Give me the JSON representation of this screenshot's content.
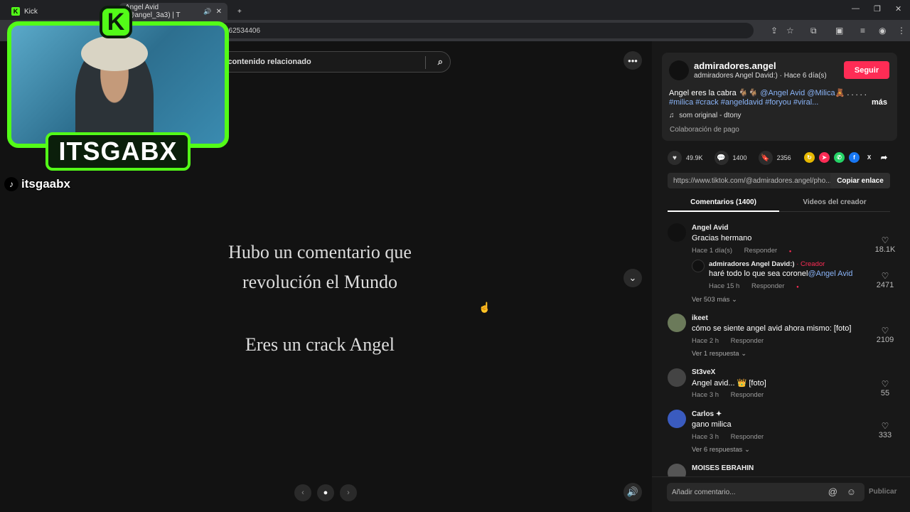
{
  "browser": {
    "tab1_title": "Kick",
    "tab2_title": "Angel Avid (@angel_3a3) | T",
    "url_fragment": "362534406",
    "new_tab_glyph": "+"
  },
  "viewer": {
    "search_placeholder": "r contenido relacionado",
    "slide_line1": "Hubo un comentario que",
    "slide_line2": "revolución el Mundo",
    "slide_line3": "Eres un crack Angel"
  },
  "stream": {
    "kick_letter": "K",
    "streamer_name": "ITSGABX",
    "tiktok_handle": "itsgaabx"
  },
  "post": {
    "username": "admiradores.angel",
    "subline": "admiradores Angel David:) · Hace 6 día(s)",
    "follow_label": "Seguir",
    "caption_start": "Angel eres la cabra 🐐🐐",
    "caption_mention1": "@Angel Avid",
    "caption_mention2": "@Milica",
    "caption_end": "🧸 . . . . .",
    "hashtags": "#milica #crack #angeldavid #foryou #viral...",
    "more_label": "más",
    "music": "som original - dtony",
    "paid": "Colaboración de pago"
  },
  "actions": {
    "likes": "49.9K",
    "comments": "1400",
    "saves": "2356",
    "share_x": "X"
  },
  "link": {
    "url": "https://www.tiktok.com/@admiradores.angel/pho...",
    "copy_label": "Copiar enlace"
  },
  "tabs": {
    "comments_tab": "Comentarios (1400)",
    "creator_tab": "Videos del creador"
  },
  "comments": [
    {
      "name": "Angel Avid",
      "text": "Gracias hermano",
      "time": "Hace 1 día(s)",
      "reply": "Responder",
      "likes": "18.1K"
    },
    {
      "name": "admiradores Angel David:)",
      "creator_tag": "· Creador",
      "text": "haré todo lo que sea coronel",
      "mention": "@Angel Avid",
      "time": "Hace 15 h",
      "reply": "Responder",
      "likes": "2471"
    },
    {
      "name": "ikeet",
      "text": "cómo se siente angel avid ahora mismo: [foto]",
      "time": "Hace 2 h",
      "reply": "Responder",
      "likes": "2109"
    },
    {
      "name": "St3veX",
      "text": "Angel avid... 👑 [foto]",
      "time": "Hace 3 h",
      "reply": "Responder",
      "likes": "55"
    },
    {
      "name": "Carlos ✦",
      "text": "gano milica",
      "time": "Hace 3 h",
      "reply": "Responder",
      "likes": "333"
    },
    {
      "name": "MOISES EBRAHIN"
    }
  ],
  "more_replies": {
    "r1": "Ver 503 más",
    "r2": "Ver 1 respuesta",
    "r3": "Ver 6 respuestas"
  },
  "composer": {
    "placeholder": "Añadir comentario...",
    "publish": "Publicar"
  }
}
